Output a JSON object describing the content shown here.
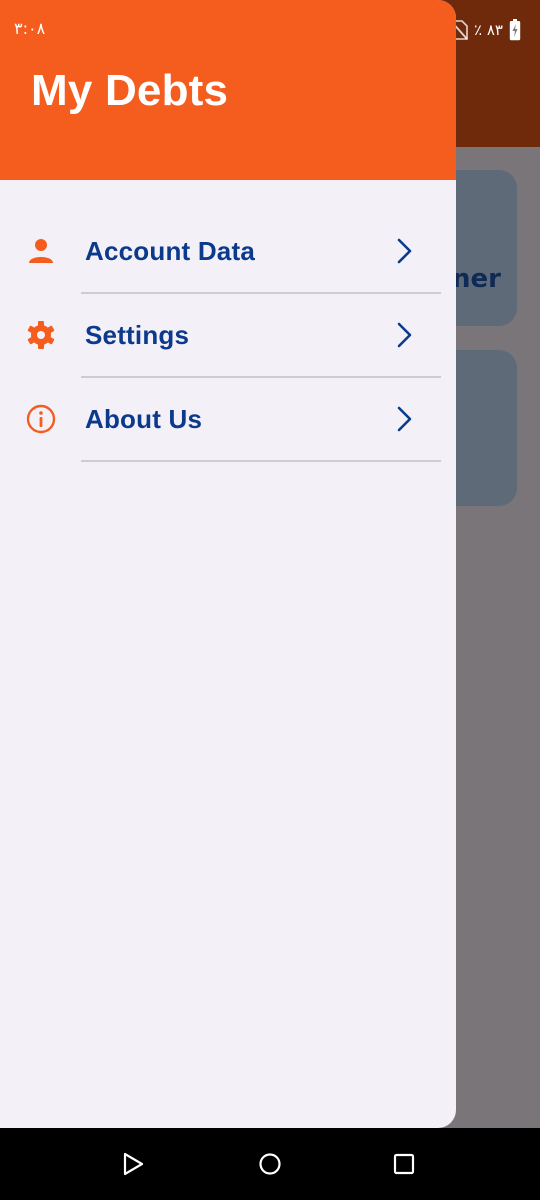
{
  "status_bar": {
    "time": "۳:۰۸",
    "battery_text": "٪ ۸۳"
  },
  "drawer": {
    "title": "My Debts",
    "items": [
      {
        "label": "Account Data",
        "icon": "person-icon"
      },
      {
        "label": "Settings",
        "icon": "gear-icon"
      },
      {
        "label": "About Us",
        "icon": "info-icon"
      }
    ]
  },
  "background": {
    "card_fragment": "ner"
  },
  "colors": {
    "accent": "#f45d1d",
    "label": "#0b3a8d",
    "drawer_bg": "#f4f0f8"
  }
}
